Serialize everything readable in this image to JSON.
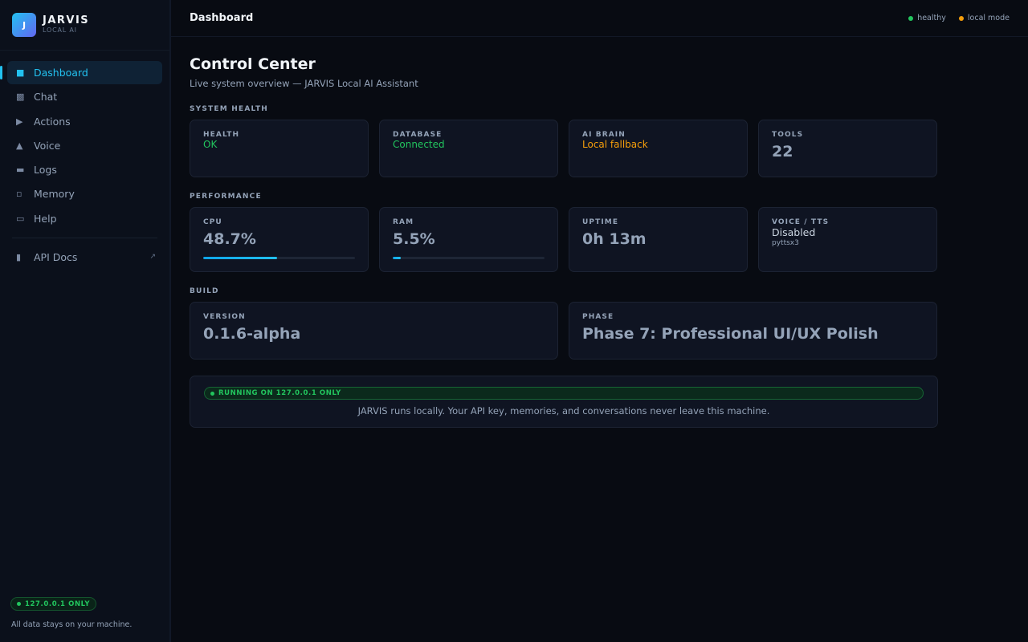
{
  "brand": {
    "logo_letter": "J",
    "name": "JARVIS",
    "subtitle": "LOCAL AI"
  },
  "sidebar": {
    "items": [
      {
        "label": "Dashboard",
        "icon": "square-icon",
        "active": true
      },
      {
        "label": "Chat",
        "icon": "chat-icon"
      },
      {
        "label": "Actions",
        "icon": "play-icon"
      },
      {
        "label": "Voice",
        "icon": "triangle-icon"
      },
      {
        "label": "Logs",
        "icon": "logs-icon"
      },
      {
        "label": "Memory",
        "icon": "memory-icon"
      },
      {
        "label": "Help",
        "icon": "help-icon"
      }
    ],
    "external": {
      "label": "API Docs",
      "icon": "docs-icon",
      "ext_icon": "external-link-icon"
    },
    "footer": {
      "badge": "127.0.0.1 ONLY",
      "note": "All data stays on your machine."
    }
  },
  "topbar": {
    "title": "Dashboard",
    "status": [
      {
        "label": "healthy",
        "color": "#22c55e"
      },
      {
        "label": "local mode",
        "color": "#f59e0b"
      }
    ]
  },
  "page": {
    "title": "Control Center",
    "subtitle": "Live system overview — JARVIS Local AI Assistant"
  },
  "sections": {
    "health": {
      "label": "SYSTEM HEALTH",
      "cards": [
        {
          "label": "HEALTH",
          "value": "OK"
        },
        {
          "label": "DATABASE",
          "value": "Connected"
        },
        {
          "label": "AI BRAIN",
          "value": "Local fallback"
        },
        {
          "label": "TOOLS",
          "value": "22"
        }
      ]
    },
    "performance": {
      "label": "PERFORMANCE",
      "cards": [
        {
          "label": "CPU",
          "value": "48.7%",
          "progress": 48.7
        },
        {
          "label": "RAM",
          "value": "5.5%",
          "progress": 5.5
        },
        {
          "label": "UPTIME",
          "value": "0h 13m"
        },
        {
          "label": "VOICE / TTS",
          "value": "Disabled",
          "detail": "pyttsx3"
        }
      ]
    },
    "build": {
      "label": "BUILD",
      "cards": [
        {
          "label": "VERSION",
          "value": "0.1.6-alpha"
        },
        {
          "label": "PHASE",
          "value": "Phase 7: Professional UI/UX Polish"
        }
      ]
    }
  },
  "notice": {
    "badge": "RUNNING ON 127.0.0.1 ONLY",
    "text": "JARVIS runs locally. Your API key, memories, and conversations never leave this machine."
  },
  "colors": {
    "accent": "#22c1f0",
    "success": "#22c55e",
    "warning": "#f59e0b",
    "background": "#080b12"
  }
}
